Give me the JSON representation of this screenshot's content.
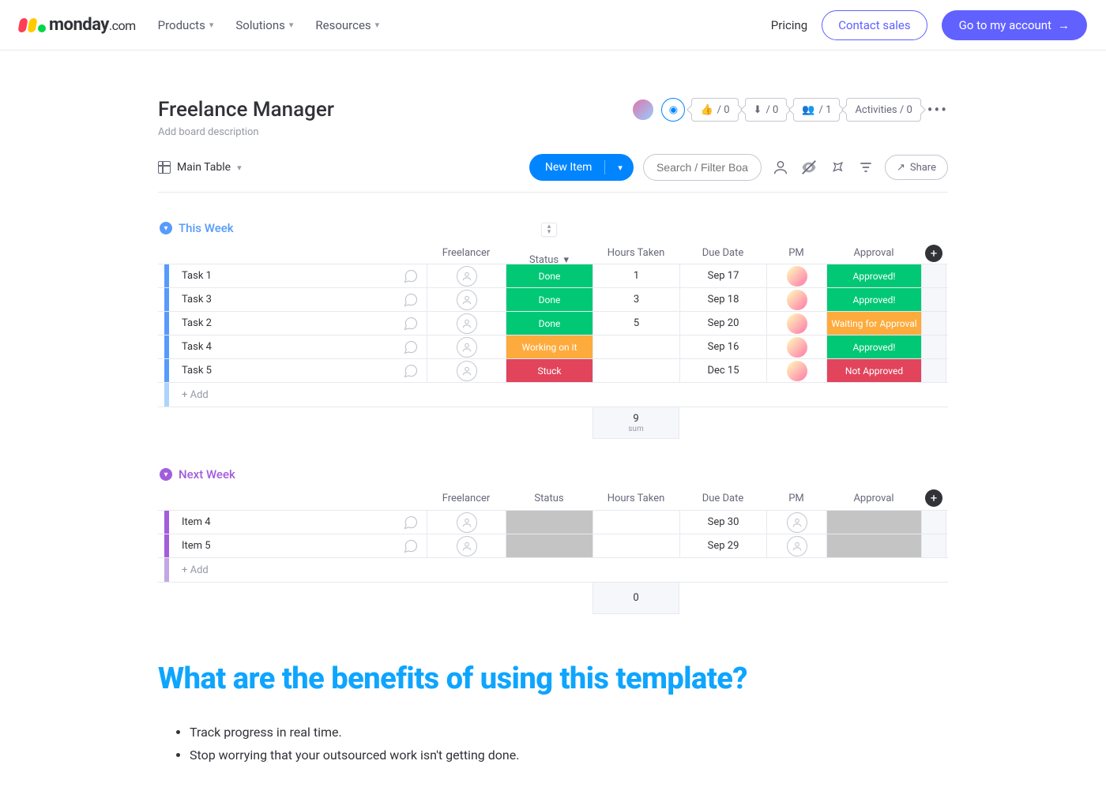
{
  "header": {
    "brand": "monday",
    "brand_suffix": ".com",
    "nav": {
      "products": "Products",
      "solutions": "Solutions",
      "resources": "Resources"
    },
    "pricing": "Pricing",
    "contact": "Contact sales",
    "account": "Go to my account"
  },
  "board": {
    "title": "Freelance Manager",
    "desc": "Add board description",
    "counters": {
      "thumbs": "/ 0",
      "downloads": "/ 0",
      "people": "/ 1",
      "activities": "Activities / 0"
    },
    "view": "Main Table",
    "new_item": "New Item",
    "search_placeholder": "Search / Filter Board",
    "share": "Share"
  },
  "columns": {
    "task": "",
    "freelancer": "Freelancer",
    "status": "Status",
    "hours": "Hours Taken",
    "due": "Due Date",
    "pm": "PM",
    "approval": "Approval"
  },
  "colors": {
    "done": "#00c875",
    "working": "#fdab3d",
    "stuck": "#e2445c",
    "approved": "#00c875",
    "waiting": "#fdab3d",
    "notapproved": "#e2445c",
    "blue": "#579bfc",
    "purple": "#a25ddc",
    "purple_light": "#c3a7e4",
    "blue_light": "#aed4fc"
  },
  "groups": [
    {
      "name": "This Week",
      "color": "#579bfc",
      "rows": [
        {
          "task": "Task 1",
          "status": "Done",
          "status_c": "done",
          "hours": "1",
          "due": "Sep 17",
          "approval": "Approved!",
          "app_c": "approved"
        },
        {
          "task": "Task 3",
          "status": "Done",
          "status_c": "done",
          "hours": "3",
          "due": "Sep 18",
          "approval": "Approved!",
          "app_c": "approved"
        },
        {
          "task": "Task 2",
          "status": "Done",
          "status_c": "done",
          "hours": "5",
          "due": "Sep 20",
          "approval": "Waiting for Approval",
          "app_c": "waiting"
        },
        {
          "task": "Task 4",
          "status": "Working on it",
          "status_c": "working",
          "hours": "",
          "due": "Sep 16",
          "approval": "Approved!",
          "app_c": "approved"
        },
        {
          "task": "Task 5",
          "status": "Stuck",
          "status_c": "stuck",
          "hours": "",
          "due": "Dec 15",
          "approval": "Not Approved",
          "app_c": "notapproved"
        }
      ],
      "add": "+ Add",
      "sum_value": "9",
      "sum_label": "sum"
    },
    {
      "name": "Next Week",
      "color": "#a25ddc",
      "rows": [
        {
          "task": "Item 4",
          "status": "",
          "hours": "",
          "due": "Sep 30",
          "approval": "",
          "gray": true
        },
        {
          "task": "Item 5",
          "status": "",
          "hours": "",
          "due": "Sep 29",
          "approval": "",
          "gray": true
        }
      ],
      "add": "+ Add",
      "sum_value": "0",
      "sum_label": ""
    }
  ],
  "benefits": {
    "heading": "What are the benefits of using this template?",
    "items": [
      "Track progress in real time.",
      "Stop worrying that your outsourced work isn't getting done."
    ]
  }
}
